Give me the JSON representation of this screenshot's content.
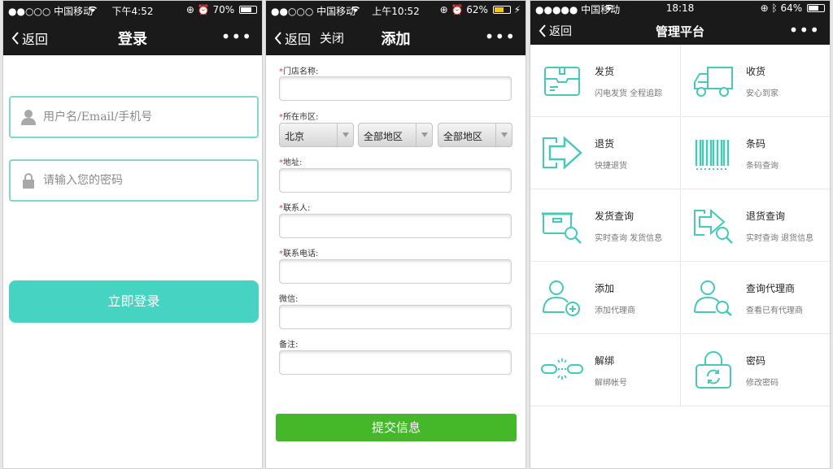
{
  "colors": {
    "accent": "#46d3c1",
    "submit": "#44b829",
    "bar": "#1a1a1a"
  },
  "panel1": {
    "status": {
      "carrier": "●●○○○ 中国移动",
      "time": "下午4:52",
      "battery": "70%",
      "battery_level": 0.7
    },
    "nav": {
      "back": "返回",
      "title": "登录",
      "more": "•••"
    },
    "username_placeholder": "用户名/Email/手机号",
    "password_placeholder": "请输入您的密码",
    "login_button": "立即登录"
  },
  "panel2": {
    "status": {
      "carrier": "●●○○○ 中国移动",
      "time": "上午10:52",
      "battery": "62%",
      "battery_level": 0.62
    },
    "nav": {
      "back": "返回",
      "close": "关闭",
      "title": "添加",
      "more": "•••"
    },
    "required_mark": "*",
    "labels": {
      "store_name": "门店名称:",
      "city": "所在市区:",
      "address": "地址:",
      "contact": "联系人:",
      "phone": "联系电话:",
      "wechat": "微信:",
      "note": "备注:"
    },
    "selects": {
      "province": "北京",
      "city": "全部地区",
      "district": "全部地区"
    },
    "submit": "提交信息"
  },
  "panel3": {
    "status": {
      "carrier": "●●●●● 中国移动",
      "time": "18:18",
      "battery": "64%",
      "battery_level": 0.64
    },
    "nav": {
      "back": "返回",
      "title": "管理平台",
      "more": "•••"
    },
    "items": [
      {
        "title": "发货",
        "desc": "闪电发货 全程追踪",
        "icon": "box-icon"
      },
      {
        "title": "收货",
        "desc": "安心到家",
        "icon": "truck-icon"
      },
      {
        "title": "退货",
        "desc": "快捷退货",
        "icon": "return-arrow-icon"
      },
      {
        "title": "条码",
        "desc": "条码查询",
        "icon": "barcode-icon"
      },
      {
        "title": "发货查询",
        "desc": "实时查询 发货信息",
        "icon": "box-search-icon"
      },
      {
        "title": "退货查询",
        "desc": "实时查询 退货信息",
        "icon": "return-search-icon"
      },
      {
        "title": "添加",
        "desc": "添加代理商",
        "icon": "user-add-icon"
      },
      {
        "title": "查询代理商",
        "desc": "查看已有代理商",
        "icon": "user-search-icon"
      },
      {
        "title": "解绑",
        "desc": "解绑帐号",
        "icon": "unlink-icon"
      },
      {
        "title": "密码",
        "desc": "修改密码",
        "icon": "lock-refresh-icon"
      }
    ]
  }
}
